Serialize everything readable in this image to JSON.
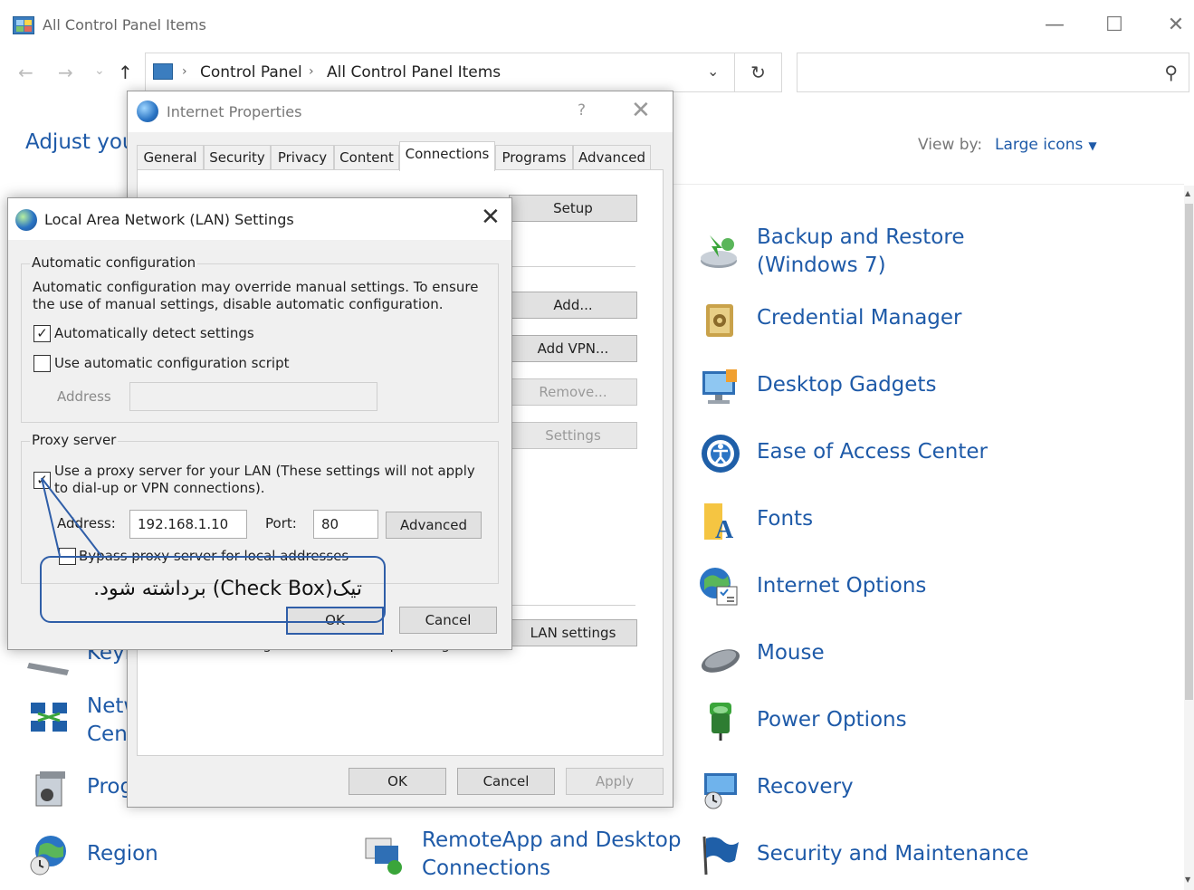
{
  "window": {
    "title": "All Control Panel Items",
    "minimize": "—",
    "maximize": "☐",
    "close": "✕"
  },
  "nav": {
    "back": "←",
    "forward": "→",
    "recent": "⌄",
    "up": "↑",
    "crumbs": [
      "Control Panel",
      "All Control Panel Items"
    ],
    "sep": "›",
    "dropdown": "⌄",
    "refresh": "↻",
    "search_placeholder": "",
    "search_icon": "⚲"
  },
  "header": {
    "adjust": "Adjust you",
    "view_by_label": "View by:",
    "view_by_value": "Large icons"
  },
  "items_right": [
    {
      "label": "Backup and Restore (Windows 7)",
      "icon": "backup-icon"
    },
    {
      "label": "Credential Manager",
      "icon": "credential-icon"
    },
    {
      "label": "Desktop Gadgets",
      "icon": "gadgets-icon"
    },
    {
      "label": "Ease of Access Center",
      "icon": "ease-of-access-icon"
    },
    {
      "label": "Fonts",
      "icon": "fonts-icon"
    },
    {
      "label": "Internet Options",
      "icon": "internet-options-icon"
    },
    {
      "label": "Mouse",
      "icon": "mouse-icon"
    },
    {
      "label": "Power Options",
      "icon": "power-icon"
    },
    {
      "label": "Recovery",
      "icon": "recovery-icon"
    },
    {
      "label": "Security and Maintenance",
      "icon": "security-icon"
    }
  ],
  "items_left": [
    {
      "label": "Keyb",
      "icon": "keyboard-icon"
    },
    {
      "label": "Netw\nCent",
      "icon": "network-icon"
    },
    {
      "label": "Prog",
      "icon": "programs-icon"
    },
    {
      "label": "Region",
      "icon": "region-icon"
    }
  ],
  "items_middle": [
    {
      "label": "RemoteApp and Desktop\nConnections",
      "icon": "remoteapp-icon"
    }
  ],
  "internet_properties": {
    "title": "Internet Properties",
    "help": "?",
    "close": "✕",
    "tabs": [
      "General",
      "Security",
      "Privacy",
      "Content",
      "Connections",
      "Programs",
      "Advanced"
    ],
    "active_tab": "Connections",
    "buttons": {
      "setup": "Setup",
      "add": "Add...",
      "add_vpn": "Add VPN...",
      "remove": "Remove...",
      "settings": "Settings",
      "lan_settings": "LAN settings",
      "ok": "OK",
      "cancel": "Cancel",
      "apply": "Apply"
    },
    "partial_text": "Choose Settings above for dial-up settings."
  },
  "lan": {
    "title": "Local Area Network (LAN) Settings",
    "close": "✕",
    "auto_group": "Automatic configuration",
    "auto_desc": "Automatic configuration may override manual settings.  To ensure the use of manual settings, disable automatic configuration.",
    "auto_detect_label": "Automatically detect settings",
    "auto_detect_checked": true,
    "auto_script_label": "Use automatic configuration script",
    "auto_script_checked": false,
    "script_address_label": "Address",
    "script_address_value": "",
    "proxy_group": "Proxy server",
    "proxy_label": "Use a proxy server for your LAN (These settings will not apply to dial-up or VPN connections).",
    "proxy_checked": true,
    "address_label": "Address:",
    "address_value": "192.168.1.10",
    "port_label": "Port:",
    "port_value": "80",
    "advanced": "Advanced",
    "bypass_label": "Bypass proxy server for local addresses",
    "bypass_checked": false,
    "ok": "OK",
    "cancel": "Cancel",
    "check_mark": "✓"
  },
  "annotation": {
    "text": "تیک(Check Box) برداشته شود."
  },
  "colors": {
    "link_blue": "#1e5aa8",
    "annotation_blue": "#2f5ea8"
  }
}
